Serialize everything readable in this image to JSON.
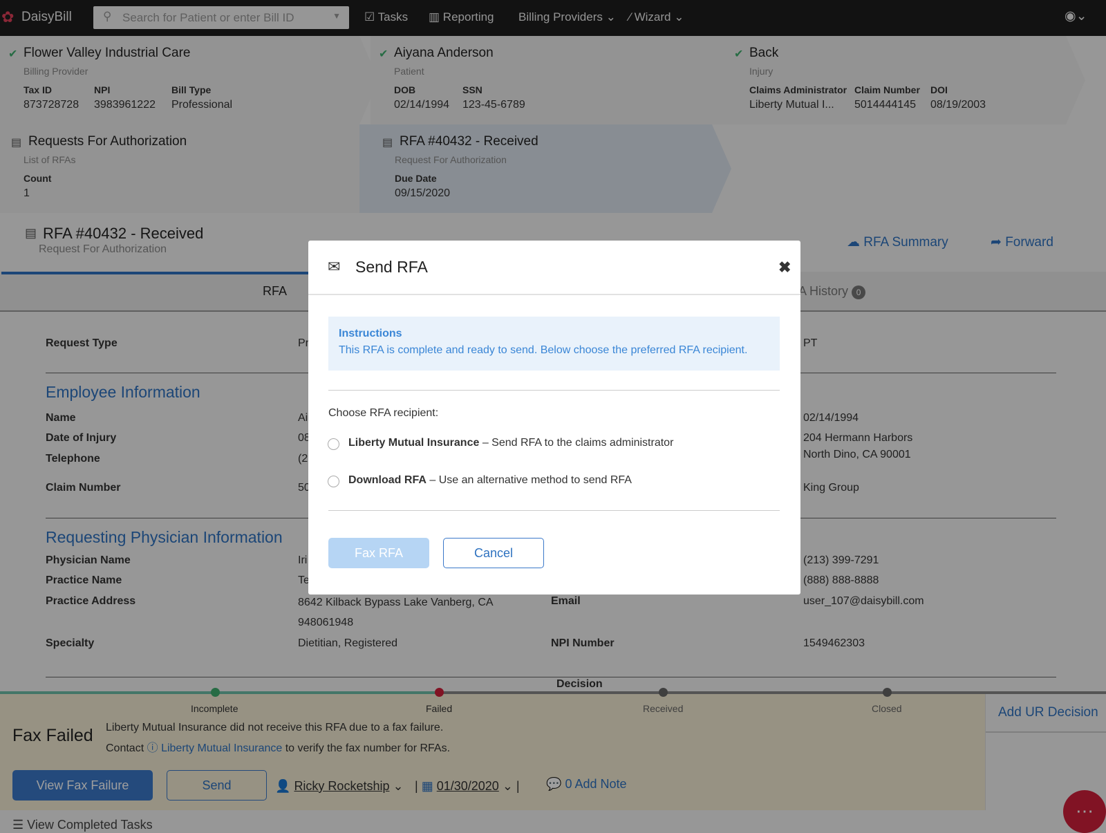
{
  "nav": {
    "brand": "DaisyBill",
    "search_placeholder": "Search for Patient or enter Bill ID",
    "tasks": "Tasks",
    "reporting": "Reporting",
    "billing_providers": "Billing Providers",
    "wizard": "Wizard"
  },
  "crumbs": {
    "provider": {
      "title": "Flower Valley Industrial Care",
      "sub": "Billing Provider",
      "fields": [
        {
          "k": "Tax ID",
          "v": "873728728"
        },
        {
          "k": "NPI",
          "v": "3983961222"
        },
        {
          "k": "Bill Type",
          "v": "Professional"
        }
      ]
    },
    "patient": {
      "title": "Aiyana Anderson",
      "sub": "Patient",
      "fields": [
        {
          "k": "DOB",
          "v": "02/14/1994"
        },
        {
          "k": "SSN",
          "v": "123-45-6789"
        }
      ]
    },
    "injury": {
      "title": "Back",
      "sub": "Injury",
      "fields": [
        {
          "k": "Claims Administrator",
          "v": "Liberty Mutual I..."
        },
        {
          "k": "Claim Number",
          "v": "5014444145"
        },
        {
          "k": "DOI",
          "v": "08/19/2003"
        }
      ]
    },
    "rfas": {
      "title": "Requests For Authorization",
      "sub": "List of RFAs",
      "fields": [
        {
          "k": "Count",
          "v": "1"
        }
      ]
    },
    "rfa": {
      "title": "RFA #40432 - Received",
      "sub": "Request For Authorization",
      "fields": [
        {
          "k": "Due Date",
          "v": "09/15/2020"
        }
      ]
    }
  },
  "header": {
    "title": "RFA #40432 - Received",
    "sub": "Request For Authorization",
    "actions": {
      "summary": "RFA Summary",
      "forward": "Forward"
    }
  },
  "tabs": {
    "rfa": "RFA",
    "history": "A History",
    "history_count": "0"
  },
  "form": {
    "request_type": {
      "label": "Request Type",
      "value": "Pr",
      "right_value": "PT"
    },
    "employee_heading": "Employee Information",
    "employee": [
      {
        "label": "Name",
        "value": "Ai",
        "right": "02/14/1994"
      },
      {
        "label": "Date of Injury",
        "value": "08",
        "right": "204 Hermann Harbors"
      },
      {
        "label": "Telephone",
        "value": "(2",
        "right": "North Dino, CA 90001"
      },
      {
        "label": "Claim Number",
        "value": "50",
        "right": "King Group"
      }
    ],
    "physician_heading": "Requesting Physician Information",
    "physician": [
      {
        "label": "Physician Name",
        "value": "Iri",
        "right": "(213) 399-7291"
      },
      {
        "label": "Practice Name",
        "value": "Te",
        "right": "(888) 888-8888"
      }
    ],
    "practice_address": {
      "label": "Practice Address",
      "value": "8642 Kilback Bypass Lake Vanberg, CA",
      "value2": "948061948",
      "mid_label": "Email",
      "right": "user_107@daisybill.com"
    },
    "specialty": {
      "label": "Specialty",
      "value": "Dietitian, Registered",
      "mid_label": "NPI Number",
      "right": "1549462303"
    },
    "decision": "Decision"
  },
  "status": {
    "steps": [
      "Incomplete",
      "Failed",
      "Received",
      "Closed"
    ],
    "title": "Fax Failed",
    "line1": "Liberty Mutual Insurance did not receive this RFA due to a fax failure.",
    "line2_pre": "Contact",
    "line2_link": "Liberty Mutual Insurance",
    "line2_post": "to verify the fax number for RFAs.",
    "view_fax_failure": "View Fax Failure",
    "send": "Send",
    "assignee": "Ricky Rocketship",
    "date": "01/30/2020",
    "add_note": "0 Add Note",
    "add_ur_decision": "Add UR Decision",
    "view_completed": "View Completed Tasks"
  },
  "modal": {
    "title": "Send RFA",
    "instructions_title": "Instructions",
    "instructions_text": "This RFA is complete and ready to send. Below choose the preferred RFA recipient.",
    "choose_label": "Choose RFA recipient:",
    "options": [
      {
        "name": "Liberty Mutual Insurance",
        "desc": "– Send RFA to the claims administrator"
      },
      {
        "name": "Download RFA",
        "desc": "– Use an alternative method to send RFA"
      }
    ],
    "fax_button": "Fax RFA",
    "cancel_button": "Cancel"
  }
}
